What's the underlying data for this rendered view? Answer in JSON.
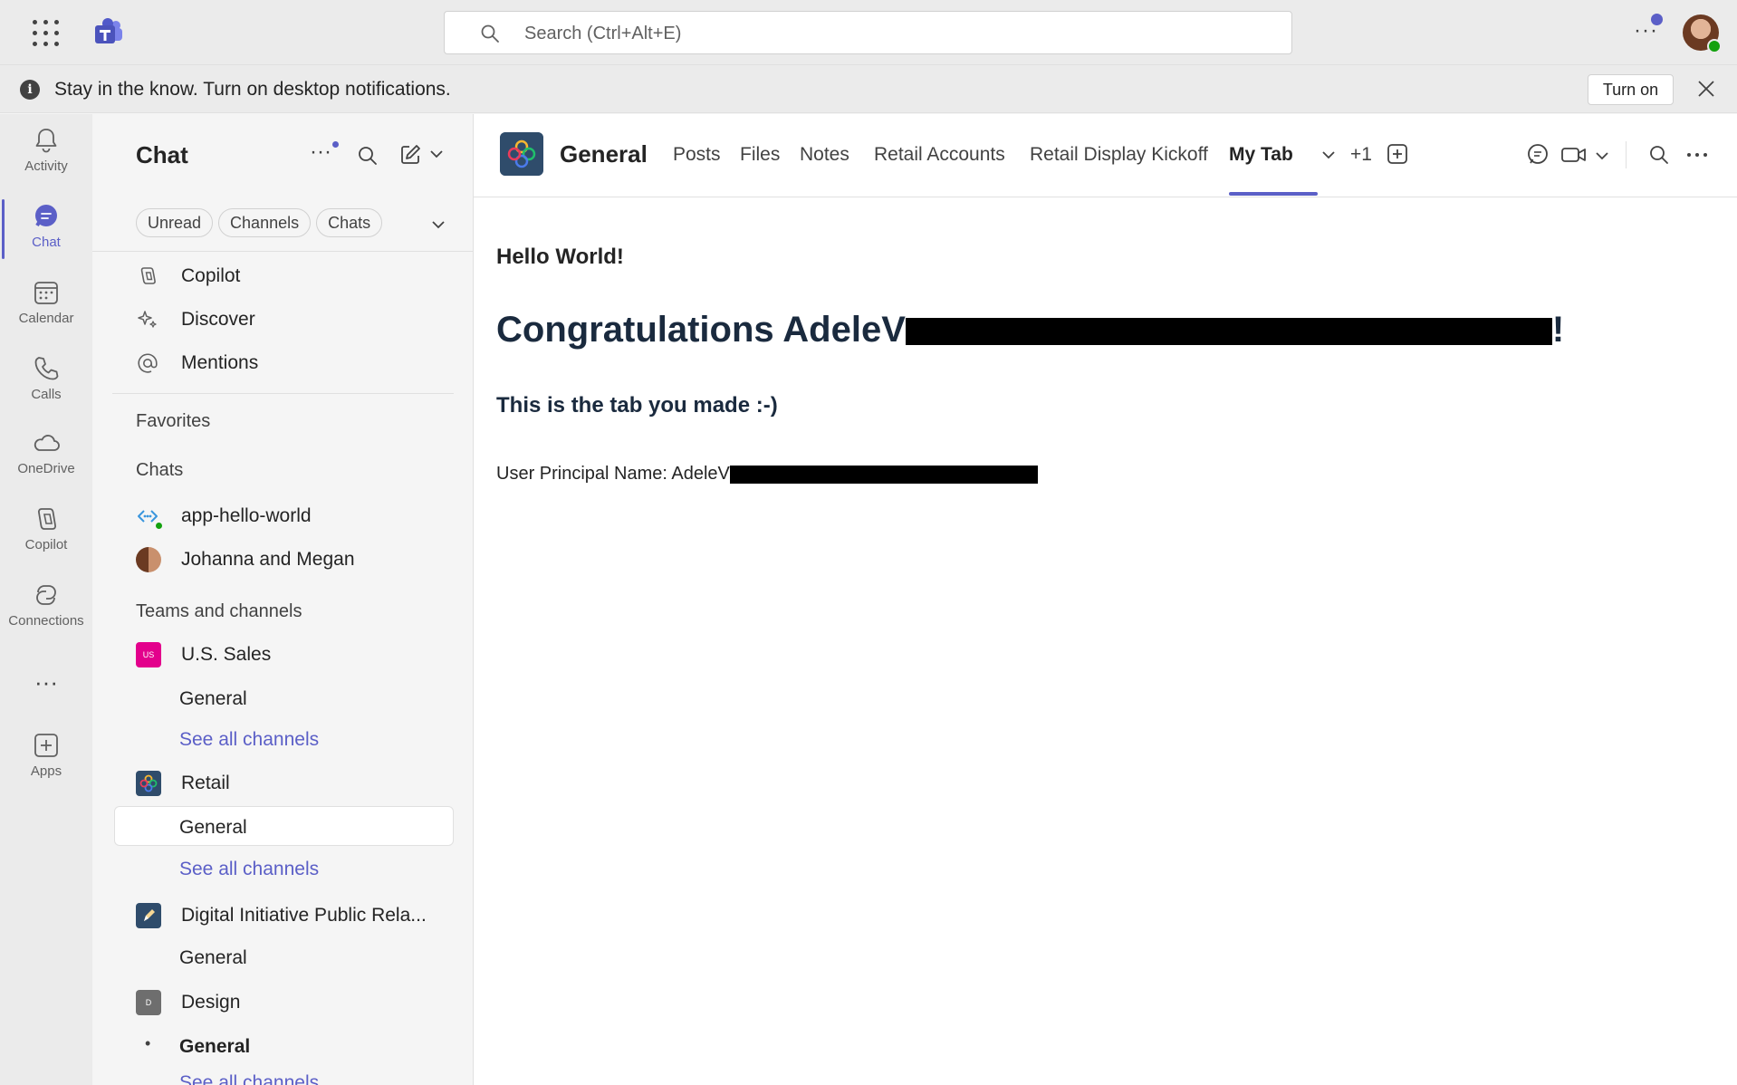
{
  "topbar": {
    "search_placeholder": "Search (Ctrl+Alt+E)",
    "more": "···"
  },
  "banner": {
    "text": "Stay in the know. Turn on desktop notifications.",
    "turn_on_label": "Turn on"
  },
  "rail": {
    "items": [
      {
        "label": "Activity",
        "icon": "bell-icon"
      },
      {
        "label": "Chat",
        "icon": "chat-icon"
      },
      {
        "label": "Calendar",
        "icon": "calendar-icon"
      },
      {
        "label": "Calls",
        "icon": "phone-icon"
      },
      {
        "label": "OneDrive",
        "icon": "cloud-icon"
      },
      {
        "label": "Copilot",
        "icon": "copilot-icon"
      },
      {
        "label": "Connections",
        "icon": "connections-icon"
      },
      {
        "label": "Apps",
        "icon": "add-app-icon"
      }
    ],
    "more": "···",
    "active_color": "#5b5fc7"
  },
  "sidebar": {
    "title": "Chat",
    "more": "···",
    "filters": [
      "Unread",
      "Channels",
      "Chats"
    ],
    "quick": [
      {
        "label": "Copilot",
        "icon": "copilot-icon"
      },
      {
        "label": "Discover",
        "icon": "sparkle-icon"
      },
      {
        "label": "Mentions",
        "icon": "at-icon"
      }
    ],
    "favorites_heading": "Favorites",
    "chats_heading": "Chats",
    "chats": [
      {
        "label": "app-hello-world"
      },
      {
        "label": "Johanna and Megan"
      }
    ],
    "teams_heading": "Teams and channels",
    "teams": [
      {
        "name": "U.S. Sales",
        "initials": "US",
        "color": "#e3008c",
        "channel": "General",
        "see_all": "See all channels"
      },
      {
        "name": "Retail",
        "channel": "General",
        "see_all": "See all channels"
      },
      {
        "name": "Digital Initiative Public Rela...",
        "channel": "General"
      },
      {
        "name": "Design",
        "initials": "D",
        "color": "#6e6e6e",
        "channel": "General",
        "see_all": "See all channels"
      }
    ]
  },
  "main": {
    "channel_name": "General",
    "tabs": [
      "Posts",
      "Files",
      "Notes",
      "Retail Accounts",
      "Retail Display Kickoff",
      "My Tab",
      "+1"
    ],
    "active_tab": "My Tab",
    "hello": "Hello World!",
    "congrats_prefix": "Congratulations AdeleV",
    "congrats_suffix": "!",
    "subtitle": "This is the tab you made :-)",
    "upn_prefix": "User Principal Name: AdeleV"
  }
}
